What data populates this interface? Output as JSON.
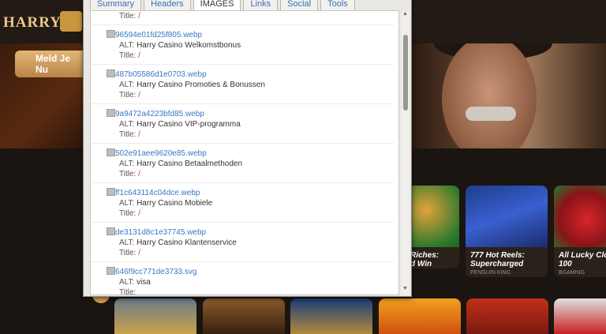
{
  "site": {
    "logo_text": "HARRY",
    "join_button": "Meld Je Nu",
    "games_row": [
      {
        "name": "Riches:",
        "name2": "d Win",
        "provider": ""
      },
      {
        "name": "777 Hot Reels:",
        "name2": "Supercharged",
        "provider": "PENGUIN KING"
      },
      {
        "name": "All Lucky Clo",
        "name2": "100",
        "provider": "BGAMING"
      }
    ]
  },
  "popup": {
    "tabs": [
      "Summary",
      "Headers",
      "IMAGES",
      "Links",
      "Social",
      "Tools"
    ],
    "active_tab": "IMAGES",
    "top_title": {
      "label": "Title:",
      "value": "/"
    },
    "images": [
      {
        "file": "96594e01fd25f805.webp",
        "alt_label": "ALT:",
        "alt": "Harry Casino Welkomstbonus",
        "title_label": "Title:",
        "title": "/"
      },
      {
        "file": "487b05586d1e0703.webp",
        "alt_label": "ALT:",
        "alt": "Harry Casino Promoties & Bonussen",
        "title_label": "Title:",
        "title": "/"
      },
      {
        "file": "9a9472a4223bfd85.webp",
        "alt_label": "ALT:",
        "alt": "Harry Casino VIP-programma",
        "title_label": "Title:",
        "title": "/"
      },
      {
        "file": "502e91aee9620e85.webp",
        "alt_label": "ALT:",
        "alt": "Harry Casino Betaalmethoden",
        "title_label": "Title:",
        "title": "/"
      },
      {
        "file": "ff1c643114c04dce.webp",
        "alt_label": "ALT:",
        "alt": "Harry Casino Mobiele",
        "title_label": "Title:",
        "title": "/"
      },
      {
        "file": "de3131d8c1e37745.webp",
        "alt_label": "ALT:",
        "alt": "Harry Casino Klantenservice",
        "title_label": "Title:",
        "title": "/"
      },
      {
        "file": "646f9cc771de3733.svg",
        "alt_label": "ALT:",
        "alt": "visa",
        "title_label": "Title:",
        "title": ""
      }
    ]
  }
}
